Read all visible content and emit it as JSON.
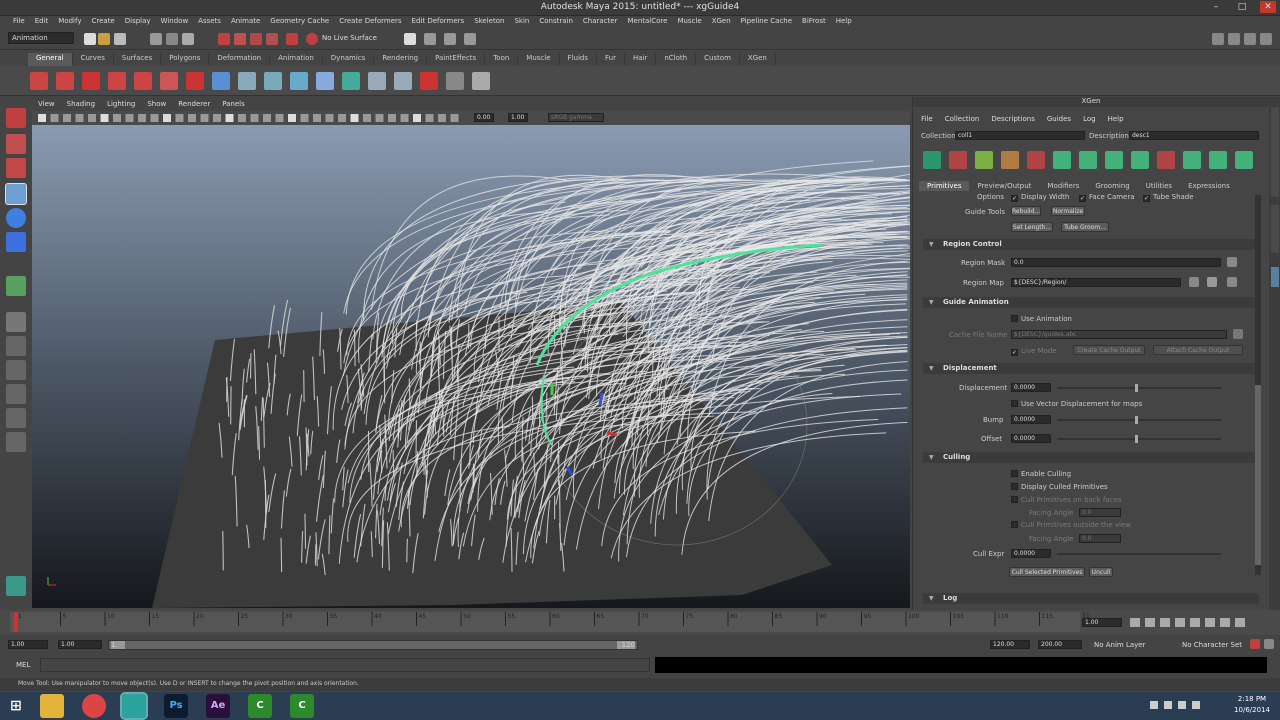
{
  "window": {
    "title": "Autodesk Maya 2015: untitled*   ---   xgGuide4"
  },
  "menubar": [
    "File",
    "Edit",
    "Modify",
    "Create",
    "Display",
    "Window",
    "Assets",
    "Animate",
    "Geometry Cache",
    "Create Deformers",
    "Edit Deformers",
    "Skeleton",
    "Skin",
    "Constrain",
    "Character",
    "MentalCore",
    "Muscle",
    "XGen",
    "Pipeline Cache",
    "BiFrost",
    "Help"
  ],
  "statusline": {
    "mode": "Animation",
    "live_surface": "No Live Surface"
  },
  "shelf_tabs": [
    "General",
    "Curves",
    "Surfaces",
    "Polygons",
    "Deformation",
    "Animation",
    "Dynamics",
    "Rendering",
    "PaintEffects",
    "Toon",
    "Muscle",
    "Fluids",
    "Fur",
    "Hair",
    "nCloth",
    "Custom",
    "XGen"
  ],
  "shelf_active": "General",
  "panel_menu": [
    "View",
    "Shading",
    "Lighting",
    "Show",
    "Renderer",
    "Panels"
  ],
  "panel_fields": {
    "near": "0.00",
    "far": "1.00",
    "colorspace": "sRGB gamma"
  },
  "xgen": {
    "header": "XGen",
    "menu": [
      "File",
      "Collection",
      "Descriptions",
      "Guides",
      "Log",
      "Help"
    ],
    "collection_label": "Collection",
    "collection_value": "coll1",
    "description_label": "Description",
    "description_value": "desc1",
    "tabs": [
      "Primitives",
      "Preview/Output",
      "Modifiers",
      "Grooming",
      "Utilities",
      "Expressions"
    ],
    "tab_active": "Primitives",
    "options_label": "Options",
    "display_width": "Display Width",
    "face_camera": "Face Camera",
    "tube_shade": "Tube Shade",
    "guide_tools_label": "Guide Tools",
    "rebuild": "Rebuild...",
    "normalize": "Normalize",
    "set_length": "Set Length...",
    "tube_groom": "Tube Groom...",
    "region_control": "Region Control",
    "region_mask_label": "Region Mask",
    "region_mask_value": "0.0",
    "region_map_label": "Region Map",
    "region_map_value": "${DESC}/Region/",
    "guide_animation": "Guide Animation",
    "use_animation": "Use Animation",
    "cache_file_label": "Cache File Name",
    "cache_file_value": "${DESC}/guides.abc",
    "live_mode": "Live Mode",
    "create_cache": "Create Cache Output",
    "attach_cache": "Attach Cache Output",
    "displacement_section": "Displacement",
    "displacement_label": "Displacement",
    "displacement_value": "0.0000",
    "use_vector_disp": "Use Vector Displacement for maps",
    "bump_label": "Bump",
    "bump_value": "0.0000",
    "offset_label": "Offset",
    "offset_value": "0.0000",
    "culling": "Culling",
    "enable_culling": "Enable Culling",
    "display_culled": "Display Culled Primitives",
    "cull_backface": "Cull Primitives on back faces",
    "facing_angle_label": "Facing Angle",
    "facing_angle_value": "0.0",
    "cull_outside": "Cull Primitives outside the view",
    "facing_angle2_value": "0.0",
    "cull_expr_label": "Cull Expr",
    "cull_expr_value": "0.0000",
    "cull_selected": "Cull Selected Primitives",
    "uncull": "Uncull",
    "log": "Log"
  },
  "timeline": {
    "ticks": [
      "1",
      "5",
      "10",
      "15",
      "20",
      "25",
      "30",
      "35",
      "40",
      "45",
      "50",
      "55",
      "60",
      "65",
      "70",
      "75",
      "80",
      "85",
      "90",
      "95",
      "100",
      "105",
      "110",
      "115",
      "120"
    ],
    "current_frame": "1.00"
  },
  "range": {
    "start": "1.00",
    "start2": "1.00",
    "range_start": "1",
    "range_end": "120",
    "end": "120.00",
    "end2": "200.00",
    "anim_layer": "No Anim Layer",
    "char_set": "No Character Set"
  },
  "cmdline": {
    "label": "MEL"
  },
  "helpline": {
    "text": "Move Tool: Use manipulator to move object(s). Use D or INSERT to change the pivot position and axis orientation."
  },
  "taskbar": {
    "time": "2:18 PM",
    "date": "10/6/2014"
  },
  "colors": {
    "guide_highlight": "#4fe39a",
    "accent": "#5285a6"
  }
}
